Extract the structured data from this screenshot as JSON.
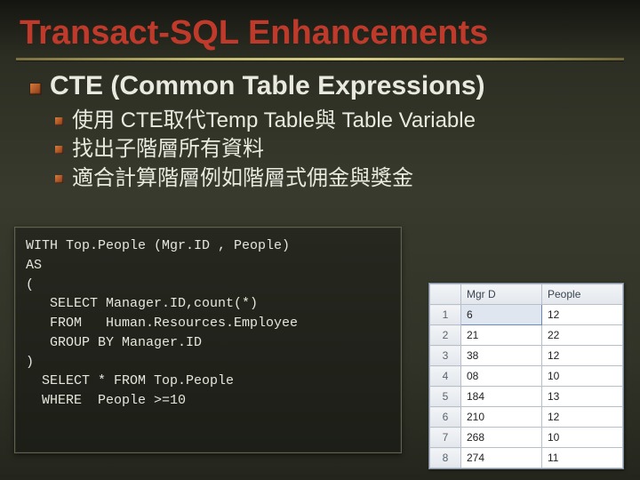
{
  "title": "Transact-SQL Enhancements",
  "section": "CTE (Common Table Expressions)",
  "bullets": [
    "使用 CTE取代Temp Table與 Table Variable",
    "找出子階層所有資料",
    "適合計算階層例如階層式佣金與獎金"
  ],
  "code": "WITH Top.People (Mgr.ID , People)\nAS\n(\n   SELECT Manager.ID,count(*)\n   FROM   Human.Resources.Employee\n   GROUP BY Manager.ID\n)\n  SELECT * FROM Top.People\n  WHERE  People >=10",
  "grid": {
    "headers": [
      "Mgr D",
      "People"
    ],
    "rows": [
      {
        "n": "1",
        "c1": "6",
        "c2": "12"
      },
      {
        "n": "2",
        "c1": "21",
        "c2": "22"
      },
      {
        "n": "3",
        "c1": "38",
        "c2": "12"
      },
      {
        "n": "4",
        "c1": "08",
        "c2": "10"
      },
      {
        "n": "5",
        "c1": "184",
        "c2": "13"
      },
      {
        "n": "6",
        "c1": "210",
        "c2": "12"
      },
      {
        "n": "7",
        "c1": "268",
        "c2": "10"
      },
      {
        "n": "8",
        "c1": "274",
        "c2": "11"
      }
    ]
  }
}
